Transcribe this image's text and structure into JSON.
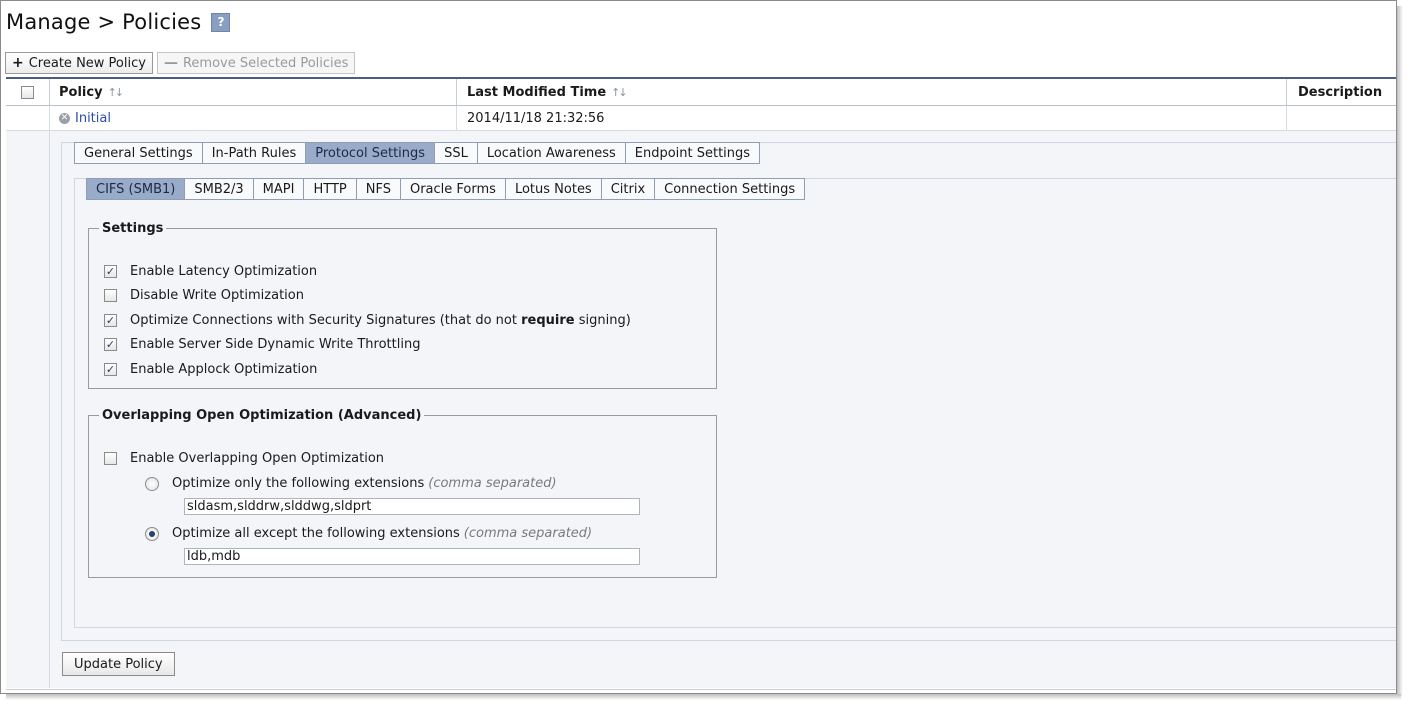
{
  "header": {
    "title": "Manage > Policies",
    "help_label": "?"
  },
  "toolbar": {
    "create_label": "Create New Policy",
    "remove_label": "Remove Selected Policies"
  },
  "table": {
    "columns": [
      "Policy",
      "Last Modified Time",
      "Description"
    ],
    "sort_glyph": "↑↓",
    "rows": [
      {
        "policy": "Initial",
        "last_modified": "2014/11/18 21:32:56",
        "description": ""
      }
    ]
  },
  "main_tabs": [
    {
      "label": "General Settings",
      "active": false
    },
    {
      "label": "In-Path Rules",
      "active": false
    },
    {
      "label": "Protocol Settings",
      "active": true
    },
    {
      "label": "SSL",
      "active": false
    },
    {
      "label": "Location Awareness",
      "active": false
    },
    {
      "label": "Endpoint Settings",
      "active": false
    }
  ],
  "sub_tabs": [
    {
      "label": "CIFS (SMB1)",
      "active": true
    },
    {
      "label": "SMB2/3",
      "active": false
    },
    {
      "label": "MAPI",
      "active": false
    },
    {
      "label": "HTTP",
      "active": false
    },
    {
      "label": "NFS",
      "active": false
    },
    {
      "label": "Oracle Forms",
      "active": false
    },
    {
      "label": "Lotus Notes",
      "active": false
    },
    {
      "label": "Citrix",
      "active": false
    },
    {
      "label": "Connection Settings",
      "active": false
    }
  ],
  "settings": {
    "legend": "Settings",
    "options": [
      {
        "label": "Enable Latency Optimization",
        "checked": true
      },
      {
        "label": "Disable Write Optimization",
        "checked": false
      },
      {
        "label_pre": "Optimize Connections with Security Signatures (that do not ",
        "label_bold": "require",
        "label_post": " signing)",
        "checked": true
      },
      {
        "label": "Enable Server Side Dynamic Write Throttling",
        "checked": true
      },
      {
        "label": "Enable Applock Optimization",
        "checked": true
      }
    ]
  },
  "overlap": {
    "legend": "Overlapping Open Optimization (Advanced)",
    "enable_label": "Enable Overlapping Open Optimization",
    "enable_checked": false,
    "only_label": "Optimize only the following extensions",
    "only_selected": false,
    "only_value": "sldasm,slddrw,slddwg,sldprt",
    "except_label": "Optimize all except the following extensions",
    "except_selected": true,
    "except_value": "ldb,mdb",
    "hint": "(comma separated)"
  },
  "actions": {
    "update_label": "Update Policy"
  },
  "colors": {
    "active_tab": "#9aabca",
    "link": "#2b4ea8",
    "header_rule": "#4a5f80",
    "panel_bg": "#f3f5f9"
  }
}
